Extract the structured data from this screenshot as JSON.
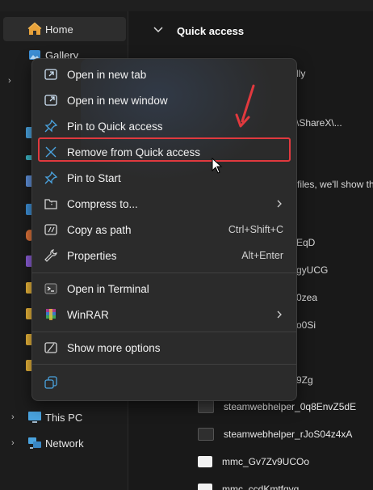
{
  "sidebar": {
    "home": "Home",
    "gallery": "Gallery",
    "this_pc": "This PC",
    "network": "Network"
  },
  "content": {
    "section_title": "Quick access",
    "partial_texts": [
      "lly",
      "\\ShareX\\...",
      "files, we'll show th",
      "EqD",
      "gyUCG",
      "0zea",
      "o0Si",
      "9Zg"
    ],
    "files": [
      {
        "name": "steamwebhelper_0q8EnvZ5dE",
        "icon": "app-icon"
      },
      {
        "name": "steamwebhelper_rJoS04z4xA",
        "icon": "app-icon"
      },
      {
        "name": "mmc_Gv7Zv9UCOo",
        "icon": "image-icon"
      },
      {
        "name": "mmc_ccdKmtfqvq",
        "icon": "image-icon"
      }
    ]
  },
  "context_menu": {
    "items": [
      {
        "label": "Open in new tab",
        "icon": "new-tab-icon"
      },
      {
        "label": "Open in new window",
        "icon": "new-window-icon"
      },
      {
        "label": "Pin to Quick access",
        "icon": "pin-icon"
      },
      {
        "label": "Remove from Quick access",
        "icon": "close-icon"
      },
      {
        "label": "Pin to Start",
        "icon": "pin-icon"
      },
      {
        "label": "Compress to...",
        "icon": "zip-folder-icon",
        "submenu": true
      },
      {
        "label": "Copy as path",
        "icon": "copy-path-icon",
        "shortcut": "Ctrl+Shift+C"
      },
      {
        "label": "Properties",
        "icon": "wrench-icon",
        "shortcut": "Alt+Enter"
      },
      {
        "label": "Open in Terminal",
        "icon": "terminal-icon"
      },
      {
        "label": "WinRAR",
        "icon": "winrar-icon",
        "submenu": true
      },
      {
        "label": "Show more options",
        "icon": "more-options-icon"
      }
    ]
  },
  "colors": {
    "accent_blue": "#4aa3df",
    "highlight_red": "#e0393e",
    "menu_bg": "#2b2b2b"
  }
}
